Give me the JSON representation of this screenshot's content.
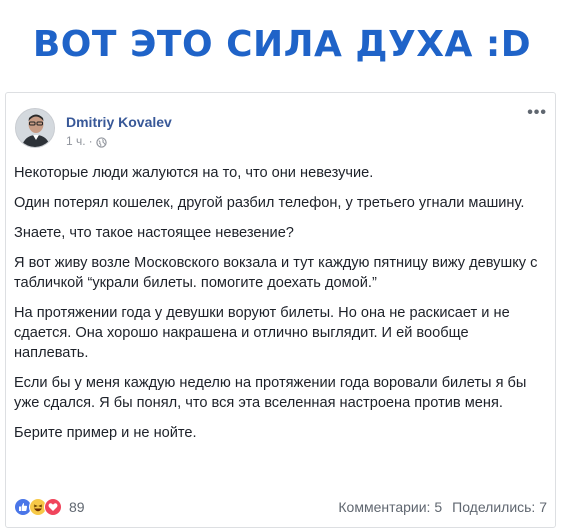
{
  "headline": "ВОТ ЭТО СИЛА ДУХА :D",
  "post": {
    "author": "Dmitriy Kovalev",
    "time": "1 ч.",
    "separator": "·",
    "more_label": "•••",
    "paragraphs": [
      "Некоторые люди жалуются на то, что они невезучие.",
      "Один потерял кошелек, другой разбил телефон, у третьего угнали машину.",
      "Знаете, что такое настоящее невезение?",
      "Я вот живу возле Московского вокзала и тут каждую пятницу вижу девушку с табличкой “украли билеты. помогите доехать домой.”",
      "На протяжении года у девушки воруют билеты. Но она не раскисает и не сдается. Она хорошо накрашена и отлично выглядит. И ей вообще наплевать.",
      "Если бы у меня каждую неделю на протяжении года воровали билеты я бы уже сдался. Я бы понял, что вся эта вселенная настроена против меня.",
      "Берите пример и не нойте."
    ],
    "reactions": [
      "like-reaction-icon",
      "haha-reaction-icon",
      "love-reaction-icon"
    ],
    "reaction_count": "89",
    "comments": "Комментарии: 5",
    "shares": "Поделились: 7"
  },
  "colors": {
    "headline": "#1f63c8",
    "author": "#385898",
    "meta": "#90949c"
  }
}
